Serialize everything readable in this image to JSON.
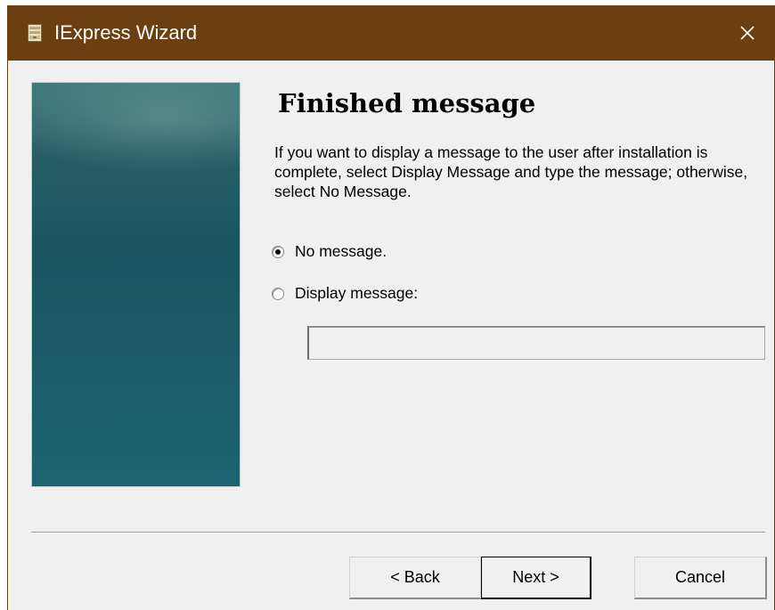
{
  "window": {
    "title": "IExpress Wizard",
    "title_bar_color": "#6b3f0f"
  },
  "page": {
    "heading": "Finished message",
    "description": "If you want to display a message to the user after installation is complete, select Display Message and type the message; otherwise, select No Message."
  },
  "options": {
    "no_message_label": "No message.",
    "no_message_selected": true,
    "display_message_label": "Display message:",
    "display_message_selected": false,
    "message_value": ""
  },
  "buttons": {
    "back": "< Back",
    "next": "Next >",
    "cancel": "Cancel"
  },
  "icons": {
    "app": "installer-package-icon",
    "close": "close-icon"
  }
}
